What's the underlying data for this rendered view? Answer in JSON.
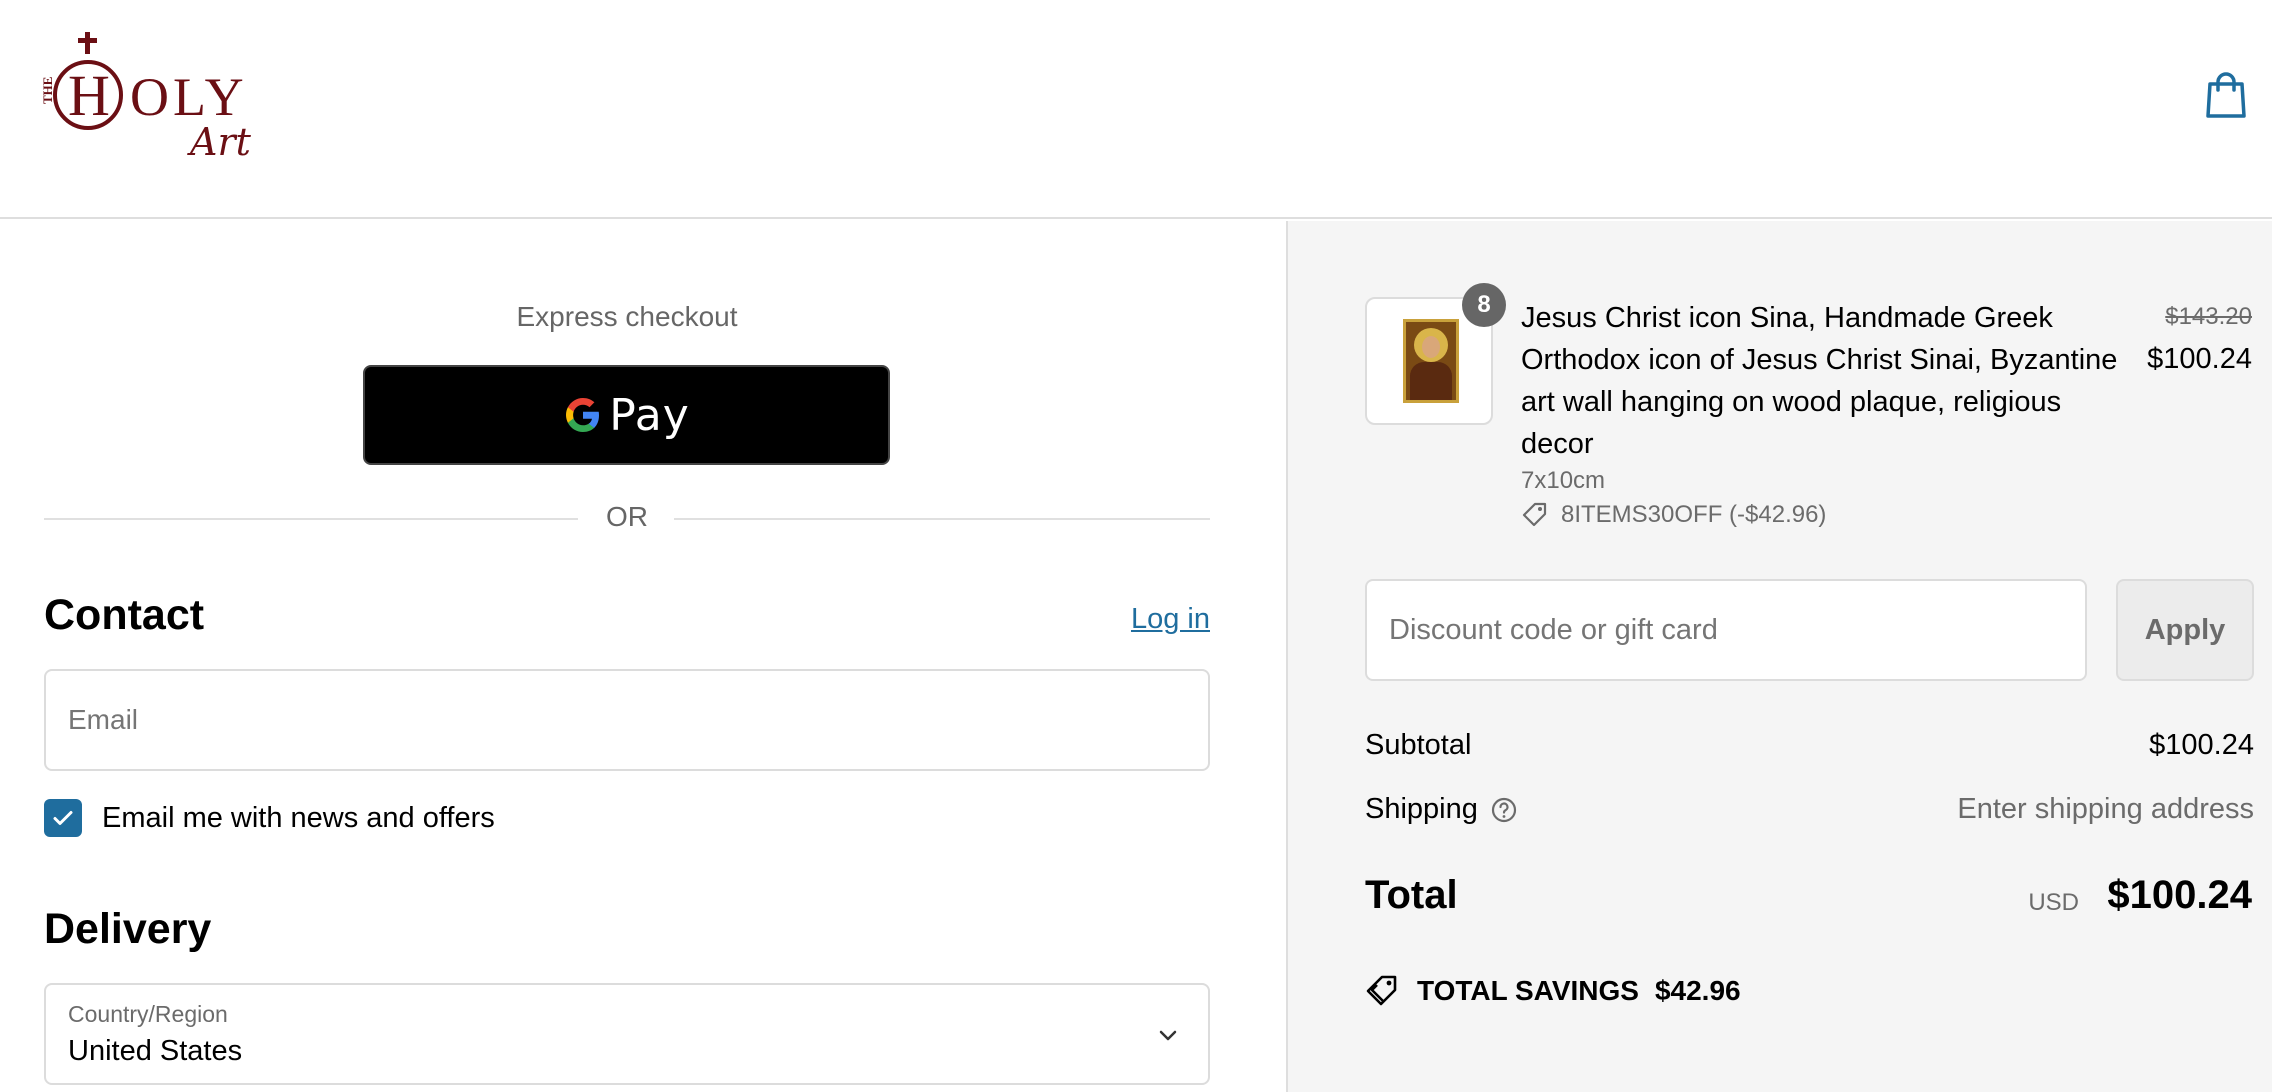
{
  "header": {
    "logo": {
      "the": "THE",
      "word": "HOLY",
      "script": "Art"
    },
    "cart_icon": "shopping-bag-icon"
  },
  "express": {
    "label": "Express checkout",
    "gpay_label": "Pay",
    "or_text": "OR"
  },
  "contact": {
    "title": "Contact",
    "login_label": "Log in",
    "email_placeholder": "Email",
    "newsletter_label": "Email me with news and offers",
    "newsletter_checked": true
  },
  "delivery": {
    "title": "Delivery",
    "country_label": "Country/Region",
    "country_value": "United States"
  },
  "order": {
    "quantity": "8",
    "product_title": "Jesus Christ icon Sina, Handmade Greek Orthodox icon of Jesus Christ Sinai, Byzantine art wall hanging on wood plaque, religious decor",
    "variant": "7x10cm",
    "discount_code": "8ITEMS30OFF (-$42.96)",
    "price_original": "$143.20",
    "price_current": "$100.24"
  },
  "discount": {
    "placeholder": "Discount code or gift card",
    "apply_label": "Apply"
  },
  "summary": {
    "subtotal_label": "Subtotal",
    "subtotal_value": "$100.24",
    "shipping_label": "Shipping",
    "shipping_value": "Enter shipping address",
    "total_label": "Total",
    "currency": "USD",
    "total_value": "$100.24",
    "savings_label": "TOTAL SAVINGS",
    "savings_value": "$42.96"
  },
  "colors": {
    "brand": "#6b0f14",
    "link": "#1f6d9e",
    "sidebar_bg": "#f5f5f5"
  }
}
